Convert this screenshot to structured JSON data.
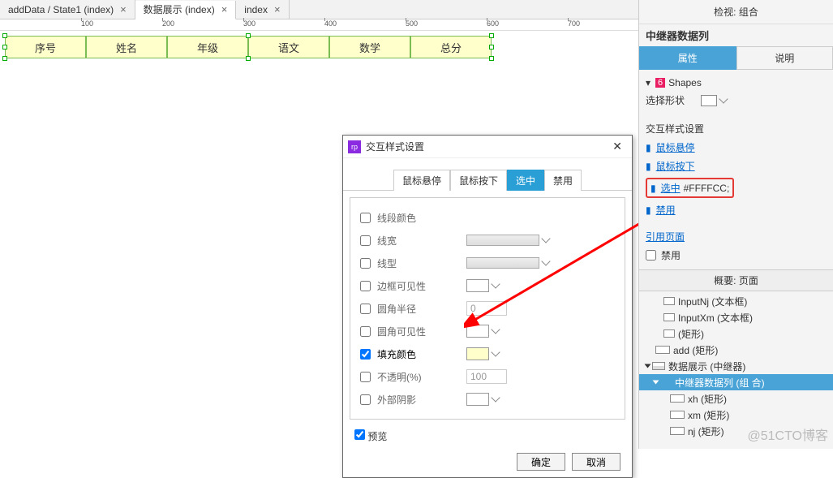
{
  "tabs": {
    "t0": "addData / State1 (index)",
    "t1": "数据展示 (index)",
    "t2": "index"
  },
  "ruler": [
    "100",
    "200",
    "300",
    "400",
    "500",
    "600",
    "700"
  ],
  "columns": [
    "序号",
    "姓名",
    "年级",
    "语文",
    "数学",
    "总分"
  ],
  "dialog": {
    "title": "交互样式设置",
    "tabs": {
      "hover": "鼠标悬停",
      "down": "鼠标按下",
      "sel": "选中",
      "dis": "禁用"
    },
    "props": {
      "segcolor": "线段颜色",
      "lw": "线宽",
      "lt": "线型",
      "bv": "边框可见性",
      "radius": "圆角半径",
      "rv": "圆角可见性",
      "fill": "填充颜色",
      "opacity": "不透明(%)",
      "shadow": "外部阴影"
    },
    "radius_val": "0",
    "opacity_val": "100",
    "preview": "预览",
    "ok": "确定",
    "cancel": "取消"
  },
  "panel": {
    "head": "检视: 组合",
    "title": "中继器数据列",
    "tab_prop": "属性",
    "tab_note": "说明",
    "shapes_count": "6",
    "shapes": "Shapes",
    "sel_shape": "选择形状",
    "ix_title": "交互样式设置",
    "hover": "鼠标悬停",
    "down": "鼠标按下",
    "sel": "选中",
    "sel_val": "#FFFFCC;",
    "dis": "禁用",
    "ref": "引用页面",
    "disable": "禁用",
    "outline": "概要: 页面",
    "tree": {
      "inputNj": "InputNj (文本框)",
      "inputXm": "InputXm (文本框)",
      "rect": "(矩形)",
      "add": "add (矩形)",
      "ds": "数据展示 (中继器)",
      "grp": "中继器数据列 (组 合)",
      "xh": "xh (矩形)",
      "xm": "xm (矩形)",
      "nj": "nj (矩形)"
    }
  },
  "watermark": "@51CTO博客"
}
